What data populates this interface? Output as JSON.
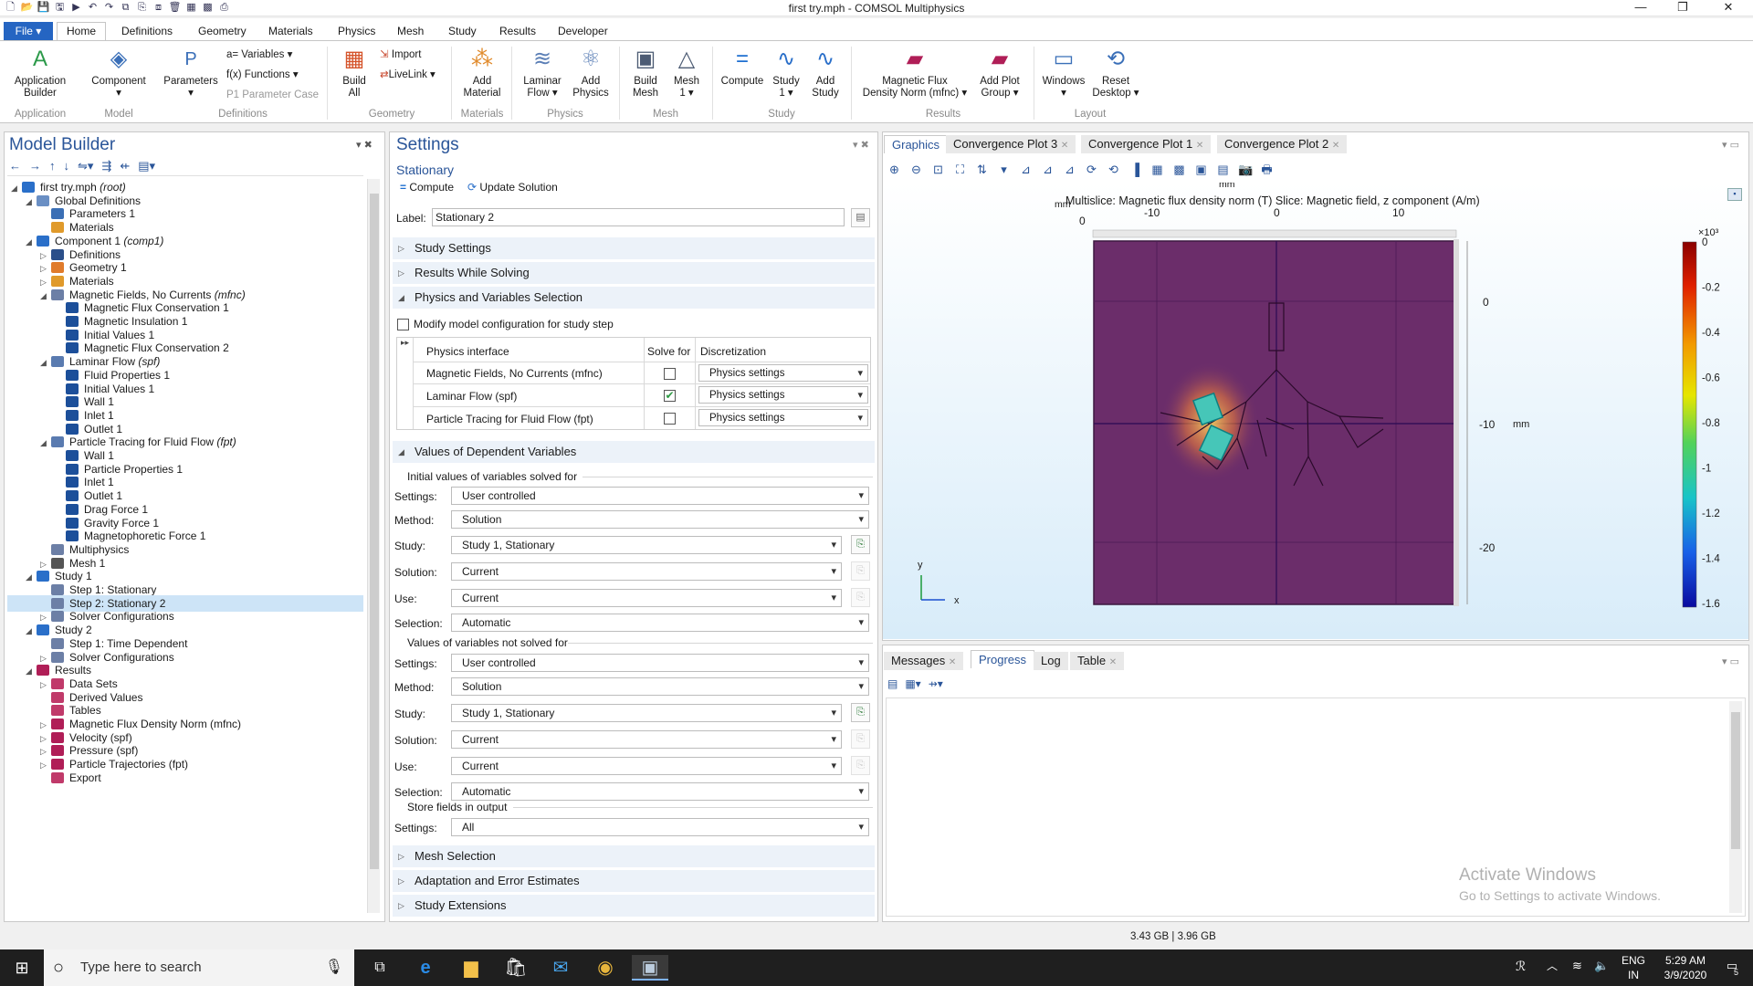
{
  "window": {
    "title": "first try.mph - COMSOL Multiphysics",
    "minimize": "—",
    "maximize": "❐",
    "close": "✕"
  },
  "quick_access": [
    "🗋",
    "📂",
    "💾",
    "🖫",
    "▶",
    "↶",
    "↷",
    "⧉",
    "⎘",
    "⧈",
    "🗑",
    "▦",
    "▩",
    "⎙"
  ],
  "ribbon_tabs": {
    "file": "File ▾",
    "items": [
      "Home",
      "Definitions",
      "Geometry",
      "Materials",
      "Physics",
      "Mesh",
      "Study",
      "Results",
      "Developer"
    ],
    "active": "Home"
  },
  "ribbon": {
    "app_builder": "Application\nBuilder",
    "component": "Component\n▾",
    "parameters": "Parameters\n▾",
    "variables": "a= Variables ▾",
    "functions": "f(x) Functions ▾",
    "param_case": "P1 Parameter Case",
    "build_all": "Build\nAll",
    "import": "Import",
    "livelink": "LiveLink ▾",
    "add_material": "Add\nMaterial",
    "laminar_flow": "Laminar\nFlow ▾",
    "add_physics": "Add\nPhysics",
    "build_mesh": "Build\nMesh",
    "mesh1": "Mesh\n1 ▾",
    "compute": "Compute",
    "study1": "Study\n1 ▾",
    "add_study": "Add\nStudy",
    "mag_flux": "Magnetic Flux\nDensity Norm (mfnc) ▾",
    "add_plot_group": "Add Plot\nGroup ▾",
    "windows": "Windows\n▾",
    "reset_desktop": "Reset\nDesktop ▾",
    "groups": [
      "Application",
      "Model",
      "Definitions",
      "Geometry",
      "Materials",
      "Physics",
      "Mesh",
      "Study",
      "Results",
      "Layout"
    ]
  },
  "model_builder": {
    "title": "Model Builder",
    "toolbar": [
      "←",
      "→",
      "↑",
      "↓",
      "⇋▾",
      "⇶",
      "⇷",
      "▤▾"
    ],
    "tree": [
      {
        "d": 0,
        "a": "◢",
        "t": "first try.mph ",
        "it": "(root)",
        "c": "#2a6fc9"
      },
      {
        "d": 1,
        "a": "◢",
        "t": "Global Definitions",
        "c": "#6a8fc4"
      },
      {
        "d": 2,
        "a": "",
        "t": "Parameters 1",
        "c": "#3b6fb5"
      },
      {
        "d": 2,
        "a": "",
        "t": "Materials",
        "c": "#e09a2b"
      },
      {
        "d": 1,
        "a": "◢",
        "t": "Component 1 ",
        "it": "(comp1)",
        "c": "#2a6fc9"
      },
      {
        "d": 2,
        "a": "▷",
        "t": "Definitions",
        "c": "#2b4f8a"
      },
      {
        "d": 2,
        "a": "▷",
        "t": "Geometry 1",
        "c": "#e07b2b"
      },
      {
        "d": 2,
        "a": "▷",
        "t": "Materials",
        "c": "#e09a2b"
      },
      {
        "d": 2,
        "a": "◢",
        "t": "Magnetic Fields, No Currents ",
        "it": "(mfnc)",
        "c": "#6c7fa6"
      },
      {
        "d": 3,
        "a": "",
        "t": "Magnetic Flux Conservation 1",
        "c": "#1c4f9a"
      },
      {
        "d": 3,
        "a": "",
        "t": "Magnetic Insulation 1",
        "c": "#1c4f9a"
      },
      {
        "d": 3,
        "a": "",
        "t": "Initial Values 1",
        "c": "#1c4f9a"
      },
      {
        "d": 3,
        "a": "",
        "t": "Magnetic Flux Conservation 2",
        "c": "#1c4f9a"
      },
      {
        "d": 2,
        "a": "◢",
        "t": "Laminar Flow ",
        "it": "(spf)",
        "c": "#5a7bb0"
      },
      {
        "d": 3,
        "a": "",
        "t": "Fluid Properties 1",
        "c": "#1c4f9a"
      },
      {
        "d": 3,
        "a": "",
        "t": "Initial Values 1",
        "c": "#1c4f9a"
      },
      {
        "d": 3,
        "a": "",
        "t": "Wall 1",
        "c": "#1c4f9a"
      },
      {
        "d": 3,
        "a": "",
        "t": "Inlet 1",
        "c": "#1c4f9a"
      },
      {
        "d": 3,
        "a": "",
        "t": "Outlet 1",
        "c": "#1c4f9a"
      },
      {
        "d": 2,
        "a": "◢",
        "t": "Particle Tracing for Fluid Flow ",
        "it": "(fpt)",
        "c": "#5a7bb0"
      },
      {
        "d": 3,
        "a": "",
        "t": "Wall 1",
        "c": "#1c4f9a"
      },
      {
        "d": 3,
        "a": "",
        "t": "Particle Properties 1",
        "c": "#1c4f9a"
      },
      {
        "d": 3,
        "a": "",
        "t": "Inlet 1",
        "c": "#1c4f9a"
      },
      {
        "d": 3,
        "a": "",
        "t": "Outlet 1",
        "c": "#1c4f9a"
      },
      {
        "d": 3,
        "a": "",
        "t": "Drag Force 1",
        "c": "#1c4f9a"
      },
      {
        "d": 3,
        "a": "",
        "t": "Gravity Force 1",
        "c": "#1c4f9a"
      },
      {
        "d": 3,
        "a": "",
        "t": "Magnetophoretic Force 1",
        "c": "#1c4f9a"
      },
      {
        "d": 2,
        "a": "",
        "t": "Multiphysics",
        "c": "#6c7fa6"
      },
      {
        "d": 2,
        "a": "▷",
        "t": "Mesh 1",
        "c": "#555"
      },
      {
        "d": 1,
        "a": "◢",
        "t": "Study 1",
        "c": "#2a6fc9"
      },
      {
        "d": 2,
        "a": "",
        "t": "Step 1: Stationary",
        "c": "#6c7fa6"
      },
      {
        "d": 2,
        "a": "",
        "t": "Step 2: Stationary 2",
        "c": "#6c7fa6",
        "sel": true
      },
      {
        "d": 2,
        "a": "▷",
        "t": "Solver Configurations",
        "c": "#6c7fa6"
      },
      {
        "d": 1,
        "a": "◢",
        "t": "Study 2",
        "c": "#2a6fc9"
      },
      {
        "d": 2,
        "a": "",
        "t": "Step 1: Time Dependent",
        "c": "#6c7fa6"
      },
      {
        "d": 2,
        "a": "▷",
        "t": "Solver Configurations",
        "c": "#6c7fa6"
      },
      {
        "d": 1,
        "a": "◢",
        "t": "Results",
        "c": "#b01e57"
      },
      {
        "d": 2,
        "a": "▷",
        "t": "Data Sets",
        "c": "#c03a6a"
      },
      {
        "d": 2,
        "a": "",
        "t": "Derived Values",
        "c": "#c03a6a"
      },
      {
        "d": 2,
        "a": "",
        "t": "Tables",
        "c": "#c03a6a"
      },
      {
        "d": 2,
        "a": "▷",
        "t": "Magnetic Flux Density Norm (mfnc)",
        "c": "#b01e57"
      },
      {
        "d": 2,
        "a": "▷",
        "t": "Velocity (spf)",
        "c": "#b01e57"
      },
      {
        "d": 2,
        "a": "▷",
        "t": "Pressure (spf)",
        "c": "#b01e57"
      },
      {
        "d": 2,
        "a": "▷",
        "t": "Particle Trajectories (fpt)",
        "c": "#b01e57"
      },
      {
        "d": 2,
        "a": "",
        "t": "Export",
        "c": "#c03a6a"
      }
    ]
  },
  "settings": {
    "title": "Settings",
    "subtitle": "Stationary",
    "compute": "Compute",
    "update": "Update Solution",
    "label_caption": "Label:",
    "label_value": "Stationary 2",
    "sections": {
      "study_settings": "Study Settings",
      "results_while": "Results While Solving",
      "physics_vars": "Physics and Variables Selection",
      "values_dep": "Values of Dependent Variables",
      "mesh_sel": "Mesh Selection",
      "adaptation": "Adaptation and Error Estimates",
      "study_ext": "Study Extensions"
    },
    "modify_config": "Modify model configuration for study step",
    "table_headers": [
      "Physics interface",
      "Solve for",
      "Discretization"
    ],
    "physics_rows": [
      {
        "name": "Magnetic Fields, No Currents (mfnc)",
        "solve": "",
        "disc": "Physics settings"
      },
      {
        "name": "Laminar Flow (spf)",
        "solve": "✔",
        "disc": "Physics settings"
      },
      {
        "name": "Particle Tracing for Fluid Flow (fpt)",
        "solve": "",
        "disc": "Physics settings"
      }
    ],
    "init_title": "Initial values of variables solved for",
    "notsolved_title": "Values of variables not solved for",
    "store_title": "Store fields in output",
    "labels": {
      "settings": "Settings:",
      "method": "Method:",
      "study": "Study:",
      "solution": "Solution:",
      "use": "Use:",
      "selection": "Selection:"
    },
    "init": {
      "settings": "User controlled",
      "method": "Solution",
      "study": "Study 1, Stationary",
      "solution": "Current",
      "use": "Current",
      "selection": "Automatic"
    },
    "notsolved": {
      "settings": "User controlled",
      "method": "Solution",
      "study": "Study 1, Stationary",
      "solution": "Current",
      "use": "Current",
      "selection": "Automatic"
    },
    "store": {
      "settings": "All"
    }
  },
  "graphics": {
    "tabs": [
      "Graphics",
      "Convergence Plot 3",
      "Convergence Plot 1",
      "Convergence Plot 2"
    ],
    "plot_title": "Multislice: Magnetic flux density norm (T)  Slice: Magnetic field, z component (A/m)",
    "x_unit_top": "mm",
    "x_unit_left": "mm",
    "x_ticks": [
      "0",
      "-10",
      "0",
      "10"
    ],
    "y_ticks": [
      "0",
      "-10",
      "-20"
    ],
    "y_unit": "mm",
    "axis_y": "y",
    "axis_x": "x",
    "colorbar_exp": "×10³",
    "colorbar_ticks": [
      "0",
      "-0.2",
      "-0.4",
      "-0.6",
      "-0.8",
      "-1",
      "-1.2",
      "-1.4",
      "-1.6"
    ],
    "colors": {
      "background_top": "#ffffff",
      "background_bottom": "#d8ecf9",
      "domain": "#6b2d6a",
      "highlight": "#3cc7c9"
    }
  },
  "messages": {
    "tabs": [
      "Messages",
      "Progress",
      "Log",
      "Table"
    ],
    "active": "Progress",
    "watermark1": "Activate Windows",
    "watermark2": "Go to Settings to activate Windows."
  },
  "status": {
    "memory": "3.43 GB | 3.96 GB"
  },
  "taskbar": {
    "search_placeholder": "Type here to search",
    "lang1": "ENG",
    "lang2": "IN",
    "time": "5:29 AM",
    "date": "3/9/2020",
    "notif": "5"
  }
}
